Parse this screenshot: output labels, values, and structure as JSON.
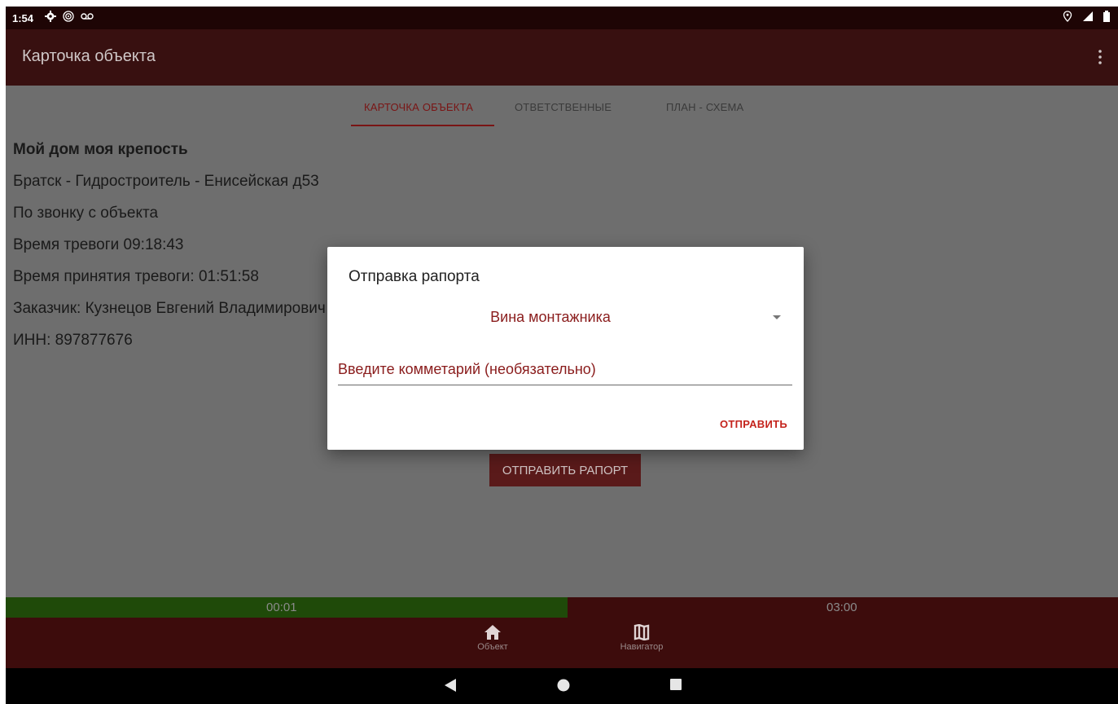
{
  "status_bar": {
    "time": "1:54",
    "icons_left": [
      "gear-icon",
      "hotspot-icon",
      "voicemail-icon"
    ],
    "icons_right": [
      "location-icon",
      "signal-icon",
      "battery-icon"
    ]
  },
  "app_bar": {
    "title": "Карточка объекта",
    "menu_icon": "more-vert-icon"
  },
  "tabs": [
    {
      "label": "КАРТОЧКА ОБЪЕКТА",
      "active": true
    },
    {
      "label": "ОТВЕТСТВЕННЫЕ",
      "active": false
    },
    {
      "label": "ПЛАН - СХЕМА",
      "active": false
    }
  ],
  "object": {
    "name": "Мой дом моя крепость",
    "address": "Братск - Гидростроитель - Енисейская д53",
    "source": "По звонку с объекта",
    "alarm_time": "Время тревоги 09:18:43",
    "accept_time": "Время принятия тревоги: 01:51:58",
    "customer": "Заказчик: Кузнецов Евгений Владимирович",
    "inn": "ИНН: 897877676"
  },
  "report_button": "ОТПРАВИТЬ РАПОРТ",
  "progress": {
    "elapsed": "00:01",
    "total": "03:00",
    "fraction": 0.505
  },
  "bottom_nav": [
    {
      "label": "Объект",
      "icon": "home-icon"
    },
    {
      "label": "Навигатор",
      "icon": "map-icon"
    }
  ],
  "system_nav": [
    "back-icon",
    "home-circle-icon",
    "recents-icon"
  ],
  "dialog": {
    "title": "Отправка рапорта",
    "selected_reason": "Вина монтажника",
    "comment_placeholder": "Введите комметарий (необязательно)",
    "send_label": "ОТПРАВИТЬ"
  },
  "colors": {
    "app_bar": "#381010",
    "accent": "#7a1515",
    "progress_fill": "#1f4a09",
    "progress_bg": "#3d0c0c"
  }
}
